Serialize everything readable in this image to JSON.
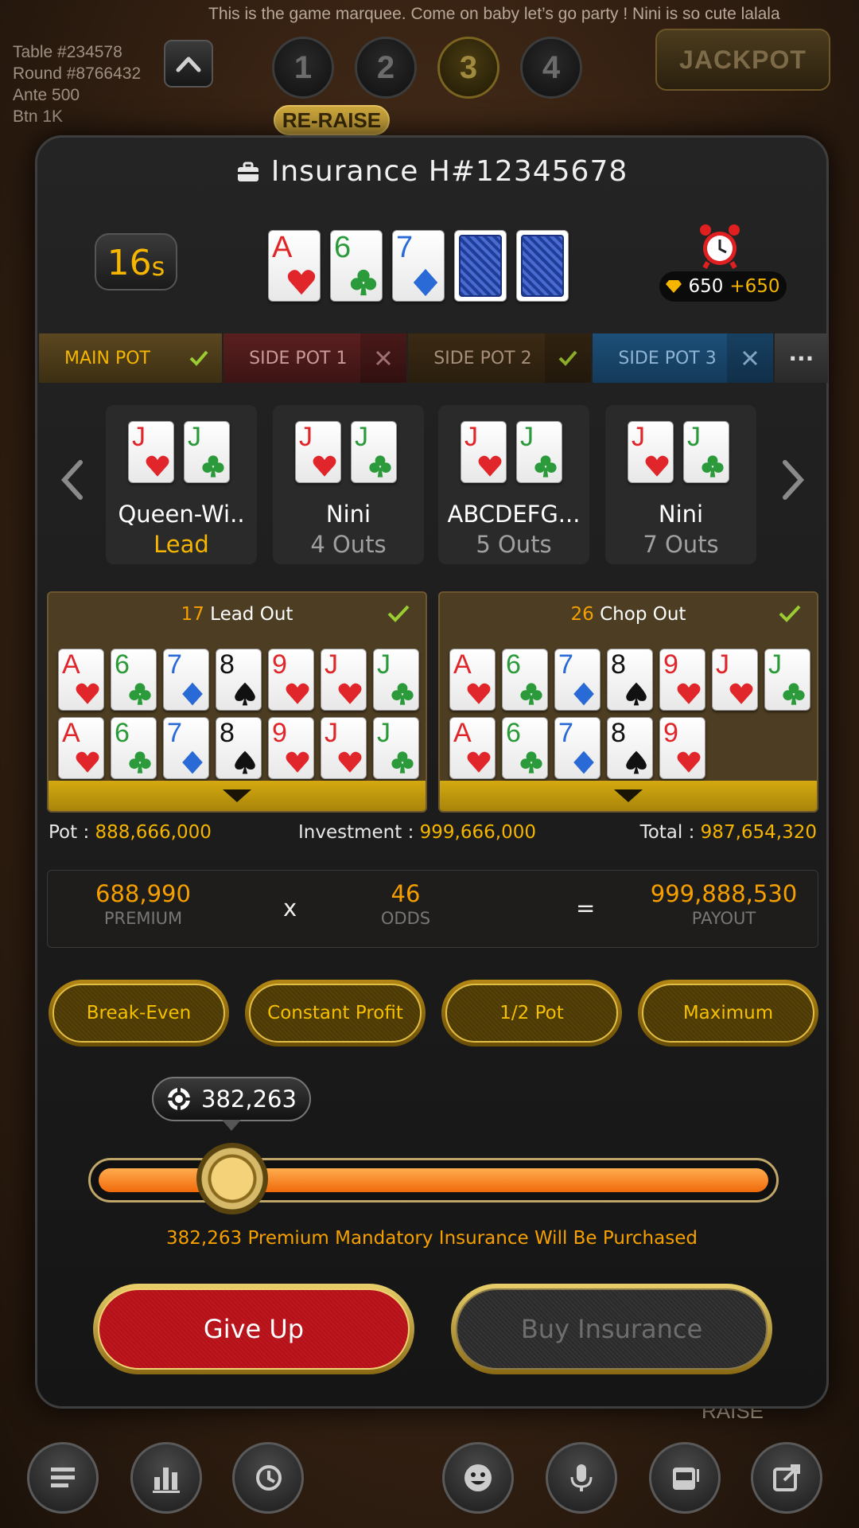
{
  "marquee": "This is the game marquee. Come on baby let’s go party ! Nini is so cute lalala",
  "table_info": {
    "table": "Table #234578",
    "round": "Round #8766432",
    "ante": "Ante 500",
    "btn": "Btn 1K"
  },
  "round_steps": [
    "1",
    "2",
    "3",
    "4"
  ],
  "active_round": "3",
  "jackpot_label": "JACKPOT",
  "reraise_label": "RE-RAISE",
  "bg_raise_label": "RAISE",
  "dialog": {
    "title": "Insurance  H#12345678",
    "timer": {
      "value": "16",
      "unit": "s"
    },
    "board": [
      {
        "rank": "A",
        "suit": "hearts"
      },
      {
        "rank": "6",
        "suit": "clubs"
      },
      {
        "rank": "7",
        "suit": "diamonds"
      },
      {
        "rank": "",
        "suit": "back"
      },
      {
        "rank": "",
        "suit": "back"
      }
    ],
    "coins": {
      "amount": "650",
      "bonus": "+650"
    },
    "tabs": [
      {
        "label": "MAIN POT",
        "status": "check"
      },
      {
        "label": "SIDE POT 1",
        "status": "x"
      },
      {
        "label": "SIDE POT 2",
        "status": "check"
      },
      {
        "label": "SIDE POT 3",
        "status": "x"
      }
    ],
    "more_label": "···",
    "players": [
      {
        "name": "Queen-Wi..",
        "status": "Lead",
        "cards": [
          {
            "rank": "J",
            "suit": "hearts"
          },
          {
            "rank": "J",
            "suit": "clubs"
          }
        ]
      },
      {
        "name": "Nini",
        "status": "4 Outs",
        "cards": [
          {
            "rank": "J",
            "suit": "hearts"
          },
          {
            "rank": "J",
            "suit": "clubs"
          }
        ]
      },
      {
        "name": "ABCDEFG...",
        "status": "5 Outs",
        "cards": [
          {
            "rank": "J",
            "suit": "hearts"
          },
          {
            "rank": "J",
            "suit": "clubs"
          }
        ]
      },
      {
        "name": "Nini",
        "status": "7 Outs",
        "cards": [
          {
            "rank": "J",
            "suit": "hearts"
          },
          {
            "rank": "J",
            "suit": "clubs"
          }
        ]
      }
    ],
    "lead_out": {
      "count": "17",
      "label": "Lead Out",
      "rows": [
        [
          {
            "rank": "A",
            "suit": "hearts"
          },
          {
            "rank": "6",
            "suit": "clubs"
          },
          {
            "rank": "7",
            "suit": "diamonds"
          },
          {
            "rank": "8",
            "suit": "spades"
          },
          {
            "rank": "9",
            "suit": "hearts"
          },
          {
            "rank": "J",
            "suit": "hearts"
          },
          {
            "rank": "J",
            "suit": "clubs"
          }
        ],
        [
          {
            "rank": "A",
            "suit": "hearts"
          },
          {
            "rank": "6",
            "suit": "clubs"
          },
          {
            "rank": "7",
            "suit": "diamonds"
          },
          {
            "rank": "8",
            "suit": "spades"
          },
          {
            "rank": "9",
            "suit": "hearts"
          },
          {
            "rank": "J",
            "suit": "hearts"
          },
          {
            "rank": "J",
            "suit": "clubs"
          }
        ]
      ]
    },
    "chop_out": {
      "count": "26",
      "label": "Chop Out",
      "rows": [
        [
          {
            "rank": "A",
            "suit": "hearts"
          },
          {
            "rank": "6",
            "suit": "clubs"
          },
          {
            "rank": "7",
            "suit": "diamonds"
          },
          {
            "rank": "8",
            "suit": "spades"
          },
          {
            "rank": "9",
            "suit": "hearts"
          },
          {
            "rank": "J",
            "suit": "hearts"
          },
          {
            "rank": "J",
            "suit": "clubs"
          }
        ],
        [
          {
            "rank": "A",
            "suit": "hearts"
          },
          {
            "rank": "6",
            "suit": "clubs"
          },
          {
            "rank": "7",
            "suit": "diamonds"
          },
          {
            "rank": "8",
            "suit": "spades"
          },
          {
            "rank": "9",
            "suit": "hearts"
          }
        ]
      ]
    },
    "summary": {
      "pot_label": "Pot : ",
      "pot_value": "888,666,000",
      "investment_label": "Investment : ",
      "investment_value": "999,666,000",
      "total_label": "Total : ",
      "total_value": "987,654,320"
    },
    "calc": {
      "premium_value": "688,990",
      "premium_label": "PREMIUM",
      "times": "x",
      "odds_value": "46",
      "odds_label": "ODDS",
      "equals": "=",
      "payout_value": "999,888,530",
      "payout_label": "PAYOUT"
    },
    "presets": [
      "Break-Even",
      "Constant Profit",
      "1/2 Pot",
      "Maximum"
    ],
    "slider": {
      "value": "382,263",
      "fraction": 0.2
    },
    "mandatory_text": "382,263 Premium Mandatory Insurance Will Be Purchased",
    "give_up_label": "Give Up",
    "buy_label": "Buy Insurance"
  },
  "colors": {
    "accent": "#f5b500",
    "hearts": "#e0262a",
    "clubs": "#2a9a3a",
    "diamonds": "#2a6ad6",
    "spades": "#111111"
  },
  "bottom_icons": [
    "menu-icon",
    "stats-icon",
    "history-icon",
    "emoji-icon",
    "mic-icon",
    "slot-machine-icon",
    "share-icon"
  ]
}
